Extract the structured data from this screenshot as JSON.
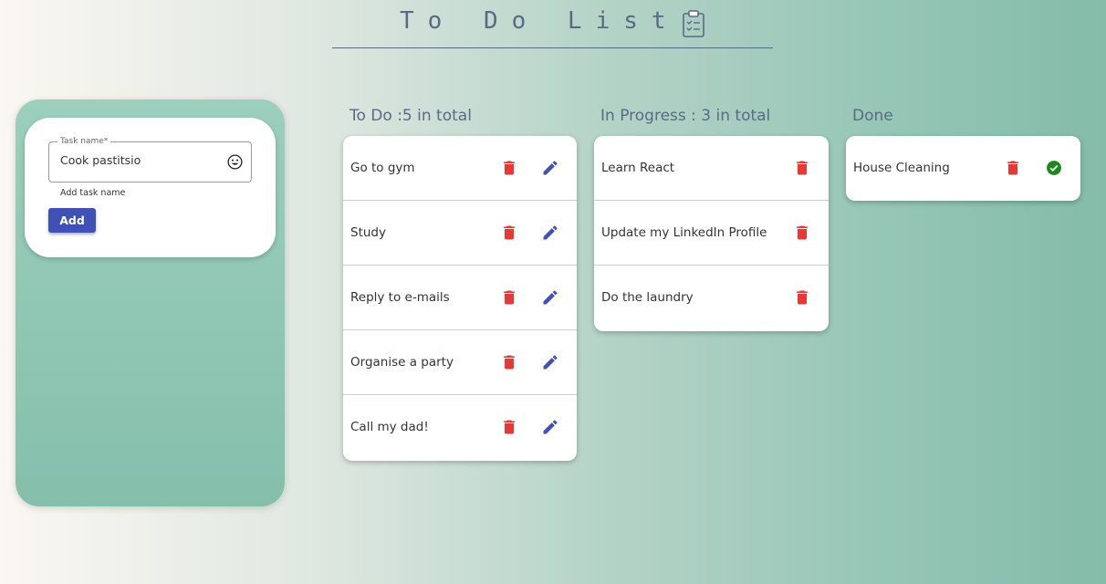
{
  "header": {
    "title": "To Do List"
  },
  "form": {
    "field_label": "Task name*",
    "task_value": "Cook pastitsio",
    "helper": "Add task name",
    "add_label": "Add"
  },
  "columns": {
    "todo": {
      "title": "To Do :5 in total",
      "items": [
        {
          "text": "Go to gym"
        },
        {
          "text": "Study"
        },
        {
          "text": "Reply to e-mails"
        },
        {
          "text": "Organise a party"
        },
        {
          "text": "Call my dad!"
        }
      ]
    },
    "progress": {
      "title": "In Progress : 3 in total",
      "items": [
        {
          "text": "Learn React"
        },
        {
          "text": "Update my LinkedIn Profile"
        },
        {
          "text": "Do the laundry"
        }
      ]
    },
    "done": {
      "title": "Done",
      "items": [
        {
          "text": "House Cleaning"
        }
      ]
    }
  },
  "icons": {
    "title": "clipboard-icon",
    "emoji": "emoji-icon",
    "delete": "delete-icon",
    "edit": "edit-icon",
    "done": "check-circle-icon"
  },
  "colors": {
    "accent": "#3f51b5",
    "delete": "#e53935",
    "done": "#1b8a1b",
    "title": "#5a6a85"
  }
}
